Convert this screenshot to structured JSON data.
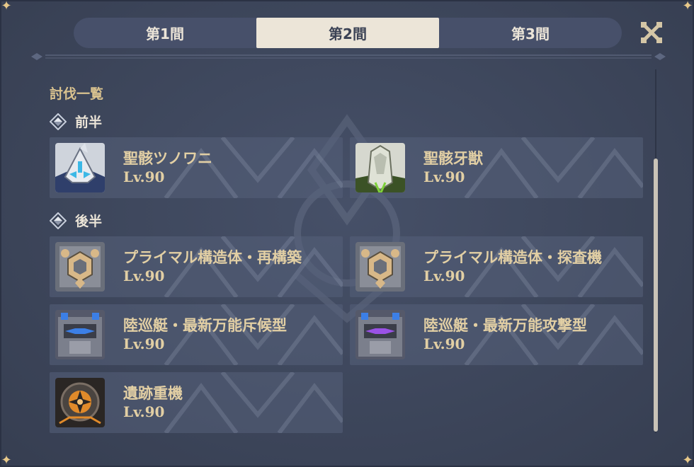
{
  "tabs": [
    {
      "label": "第1間",
      "active": false
    },
    {
      "label": "第2間",
      "active": true
    },
    {
      "label": "第3間",
      "active": false
    }
  ],
  "section_title": "討伐一覧",
  "groups": [
    {
      "label": "前半"
    },
    {
      "label": "後半"
    }
  ],
  "enemies": [
    {
      "name": "聖骸ツノワニ",
      "level": "Lv.90",
      "icon": "horned-crocodile-portrait"
    },
    {
      "name": "聖骸牙獣",
      "level": "Lv.90",
      "icon": "fanged-beast-portrait"
    },
    {
      "name": "プライマル構造体・再構築",
      "level": "Lv.90",
      "icon": "primal-construct-portrait"
    },
    {
      "name": "プライマル構造体・探査機",
      "level": "Lv.90",
      "icon": "primal-construct-portrait"
    },
    {
      "name": "陸巡艇・最新万能斥候型",
      "level": "Lv.90",
      "icon": "ruin-drake-blue-portrait"
    },
    {
      "name": "陸巡艇・最新万能攻撃型",
      "level": "Lv.90",
      "icon": "ruin-drake-purple-portrait"
    },
    {
      "name": "遺跡重機",
      "level": "Lv.90",
      "icon": "ruin-grader-portrait"
    }
  ],
  "colors": {
    "panel": "#3d465b",
    "tab_bar": "#47506a",
    "tab_active": "#ece5d8",
    "gold_text": "#e2cfa4",
    "card": "#56607a"
  }
}
